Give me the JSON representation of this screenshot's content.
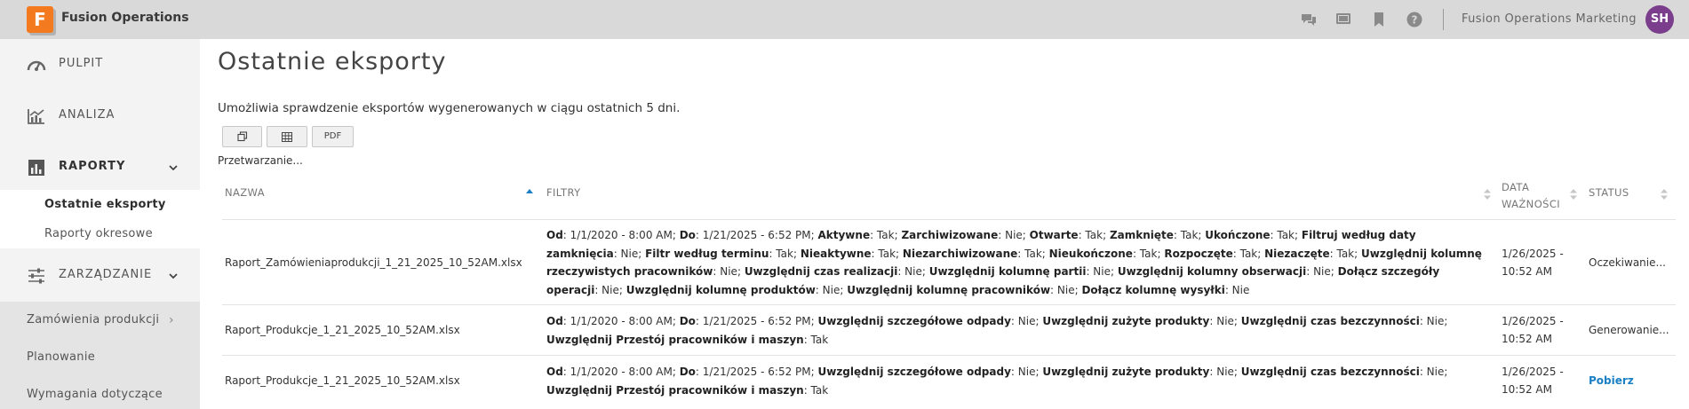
{
  "app": {
    "logo_letter": "F",
    "title": "Fusion Operations",
    "account_name": "Fusion Operations Marketing",
    "avatar_initials": "SH"
  },
  "sidebar": {
    "items": [
      {
        "label": "PULPIT",
        "icon": "speedometer-icon"
      },
      {
        "label": "ANALIZA",
        "icon": "chart-icon"
      },
      {
        "label": "RAPORTY",
        "icon": "report-icon"
      },
      {
        "label": "ZARZĄDZANIE",
        "icon": "sliders-icon"
      }
    ],
    "reports_sub": [
      "Ostatnie eksporty",
      "Raporty okresowe"
    ],
    "management_sub": [
      "Zamówienia produkcji",
      "Planowanie",
      "Wymagania dotyczące"
    ]
  },
  "page": {
    "title": "Ostatnie eksporty",
    "description": "Umożliwia sprawdzenie eksportów wygenerowanych w ciągu ostatnich 5 dni.",
    "buttons": {
      "copy_icon": "copy-icon",
      "csv_icon": "table-icon",
      "pdf": "PDF"
    },
    "processing": "Przetwarzanie..."
  },
  "table": {
    "columns": {
      "name": "NAZWA",
      "filters": "FILTRY",
      "date_line1": "DATA",
      "date_line2": "WAŻNOŚCI",
      "status": "STATUS"
    },
    "rows": [
      {
        "name": "Raport_Zamówieniaprodukcji_1_21_2025_10_52AM.xlsx",
        "filters": [
          [
            "Od",
            "1/1/2020 - 8:00 AM"
          ],
          [
            "Do",
            "1/21/2025 - 6:52 PM"
          ],
          [
            "Aktywne",
            "Tak"
          ],
          [
            "Zarchiwizowane",
            "Nie"
          ],
          [
            "Otwarte",
            "Tak"
          ],
          [
            "Zamknięte",
            "Tak"
          ],
          [
            "Ukończone",
            "Tak"
          ],
          [
            "Filtruj według daty zamknięcia",
            "Nie"
          ],
          [
            "Filtr według terminu",
            "Tak"
          ],
          [
            "Nieaktywne",
            "Tak"
          ],
          [
            "Niezarchiwizowane",
            "Tak"
          ],
          [
            "Nieukończone",
            "Tak"
          ],
          [
            "Rozpoczęte",
            "Tak"
          ],
          [
            "Niezaczęte",
            "Tak"
          ],
          [
            "Uwzględnij kolumnę rzeczywistych pracowników",
            "Nie"
          ],
          [
            "Uwzględnij czas realizacji",
            "Nie"
          ],
          [
            "Uwzględnij kolumnę partii",
            "Nie"
          ],
          [
            "Uwzględnij kolumny obserwacji",
            "Nie"
          ],
          [
            "Dołącz szczegóły operacji",
            "Nie"
          ],
          [
            "Uwzględnij kolumnę produktów",
            "Nie"
          ],
          [
            "Uwzględnij kolumnę pracowników",
            "Nie"
          ],
          [
            "Dołącz kolumnę wysyłki",
            "Nie"
          ]
        ],
        "date": "1/26/2025 -",
        "time": "10:52 AM",
        "status": "Oczekiwanie...",
        "status_is_link": false
      },
      {
        "name": "Raport_Produkcje_1_21_2025_10_52AM.xlsx",
        "filters": [
          [
            "Od",
            "1/1/2020 - 8:00 AM"
          ],
          [
            "Do",
            "1/21/2025 - 6:52 PM"
          ],
          [
            "Uwzględnij szczegółowe odpady",
            "Nie"
          ],
          [
            "Uwzględnij zużyte produkty",
            "Nie"
          ],
          [
            "Uwzględnij czas bezczynności",
            "Nie"
          ],
          [
            "Uwzględnij Przestój pracowników i maszyn",
            "Tak"
          ]
        ],
        "date": "1/26/2025 -",
        "time": "10:52 AM",
        "status": "Generowanie...",
        "status_is_link": false
      },
      {
        "name": "Raport_Produkcje_1_21_2025_10_52AM.xlsx",
        "filters": [
          [
            "Od",
            "1/1/2020 - 8:00 AM"
          ],
          [
            "Do",
            "1/21/2025 - 6:52 PM"
          ],
          [
            "Uwzględnij szczegółowe odpady",
            "Nie"
          ],
          [
            "Uwzględnij zużyte produkty",
            "Nie"
          ],
          [
            "Uwzględnij czas bezczynności",
            "Nie"
          ],
          [
            "Uwzględnij Przestój pracowników i maszyn",
            "Tak"
          ]
        ],
        "date": "1/26/2025 -",
        "time": "10:52 AM",
        "status": "Pobierz",
        "status_is_link": true
      }
    ]
  },
  "colors": {
    "accent": "#f47a20",
    "avatar": "#7a3e8c",
    "link": "#1a7fc4",
    "sort_active": "#1a7fc4"
  }
}
